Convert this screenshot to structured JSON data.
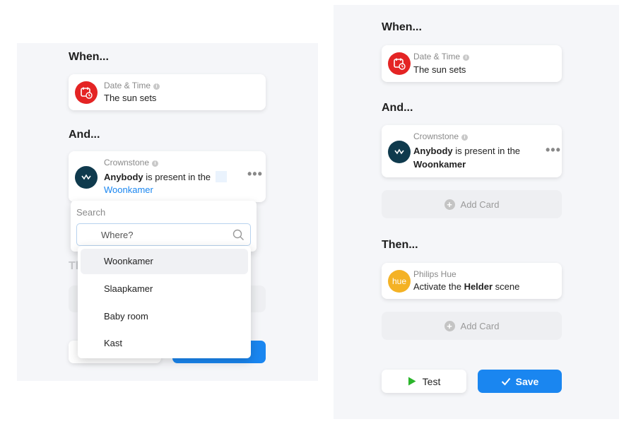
{
  "left": {
    "when_title": "When...",
    "and_title": "And...",
    "then_partial": "Th",
    "date_card": {
      "app": "Date & Time",
      "text": "The sun sets",
      "icon": "calendar-clock-icon",
      "color": "#e42424"
    },
    "crownstone_card": {
      "app": "Crownstone",
      "subject": "Anybody",
      "middle": "is present in the",
      "location": "Woonkamer",
      "icon": "crown-icon",
      "color": "#0f3a4d"
    },
    "dropdown": {
      "search_label": "Search",
      "placeholder": "Where?",
      "options": [
        "Woonkamer",
        "Slaapkamer",
        "Baby room",
        "Kast"
      ],
      "selected": "Woonkamer"
    }
  },
  "right": {
    "when_title": "When...",
    "and_title": "And...",
    "then_title": "Then...",
    "date_card": {
      "app": "Date & Time",
      "text": "The sun sets"
    },
    "crownstone_card": {
      "app": "Crownstone",
      "subject": "Anybody",
      "middle": "is present in the",
      "location": "Woonkamer"
    },
    "hue_card": {
      "app": "Philips Hue",
      "prefix": "Activate the",
      "scene": "Helder",
      "suffix": "scene",
      "icon_text": "hue",
      "color": "#f4b225"
    },
    "add_card_label": "Add Card",
    "test_label": "Test",
    "save_label": "Save",
    "accent": "#1a86f0"
  }
}
